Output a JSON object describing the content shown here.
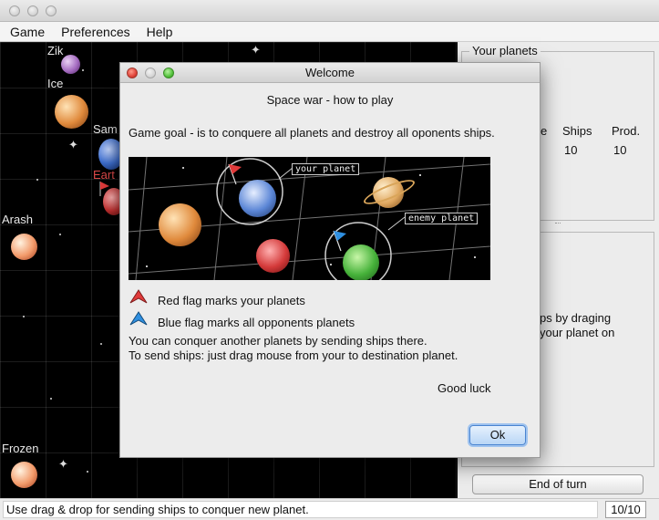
{
  "menu": [
    "Game",
    "Preferences",
    "Help"
  ],
  "board": {
    "planets": [
      {
        "name": "Zik",
        "owner": "none"
      },
      {
        "name": "Ice",
        "owner": "none"
      },
      {
        "name": "Sam",
        "owner": "none"
      },
      {
        "name": "Eart",
        "owner": "player"
      },
      {
        "name": "Arash",
        "owner": "none"
      },
      {
        "name": "Frozen",
        "owner": "none"
      }
    ]
  },
  "panel": {
    "your_planets_legend": "Your planets",
    "columns": [
      "e",
      "Ships",
      "Prod."
    ],
    "row": [
      "10",
      "10"
    ],
    "hint_lines": [
      "ps by draging",
      "your planet on"
    ],
    "end_turn_label": "End of turn"
  },
  "status": {
    "text": "Use drag & drop for sending ships to conquer new planet.",
    "counter": "10/10"
  },
  "dialog": {
    "title": "Welcome",
    "heading": "Space war - how to play",
    "goal": "Game goal - is to conquere all planets and destroy all oponents ships.",
    "illustration_labels": {
      "your": "your planet",
      "enemy": "enemy planet"
    },
    "red_flag": "Red flag marks your planets",
    "blue_flag": "Blue flag marks all opponents planets",
    "conquer": "You can conquer another planets by sending ships there.",
    "send": "To send ships: just drag mouse from your to destination planet.",
    "luck": "Good luck",
    "ok": "Ok"
  },
  "colors": {
    "player_flag": "#e03a3a",
    "enemy_flag": "#2f8fe0",
    "accent": "#4a84d0"
  }
}
